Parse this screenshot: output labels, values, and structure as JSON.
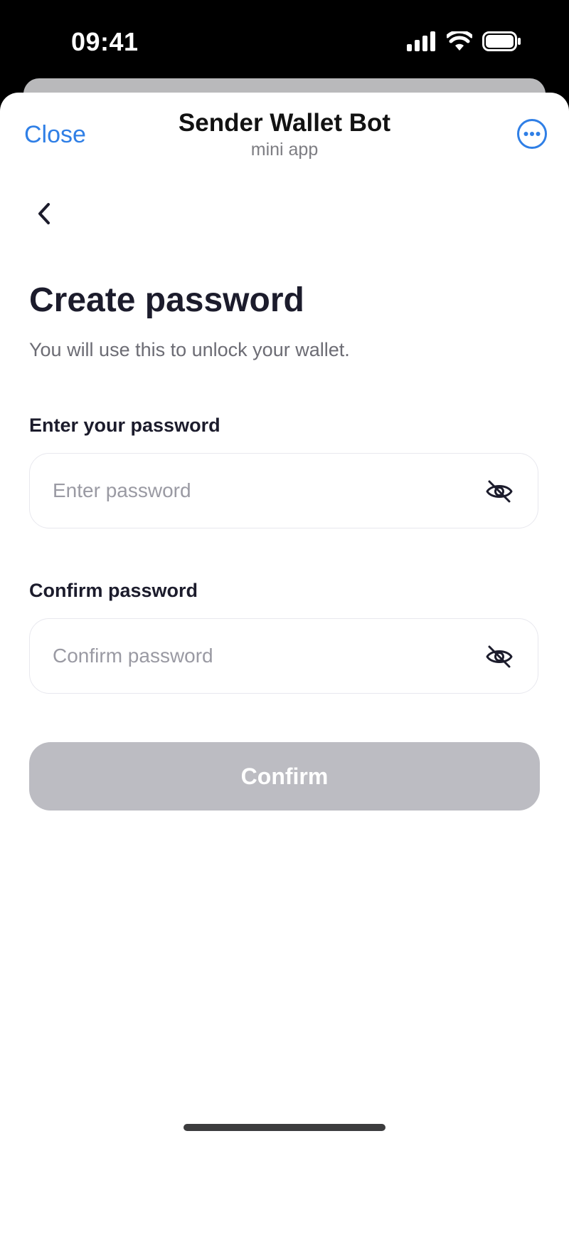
{
  "status_bar": {
    "time": "09:41",
    "icons": [
      "cellular-signal-icon",
      "wifi-icon",
      "battery-icon"
    ]
  },
  "header": {
    "close_label": "Close",
    "title": "Sender Wallet Bot",
    "subtitle": "mini app",
    "more_icon": "more-options-icon"
  },
  "page": {
    "back_icon": "chevron-left-icon",
    "title": "Create password",
    "description": "You will use this to unlock your wallet."
  },
  "form": {
    "password": {
      "label": "Enter your password",
      "placeholder": "Enter password",
      "value": "",
      "toggle_icon": "eye-slash-icon"
    },
    "confirm": {
      "label": "Confirm password",
      "placeholder": "Confirm password",
      "value": "",
      "toggle_icon": "eye-slash-icon"
    },
    "submit_label": "Confirm"
  },
  "colors": {
    "accent": "#2f7fe6",
    "button_disabled": "#bcbcc2",
    "heading": "#1c1c2c"
  }
}
